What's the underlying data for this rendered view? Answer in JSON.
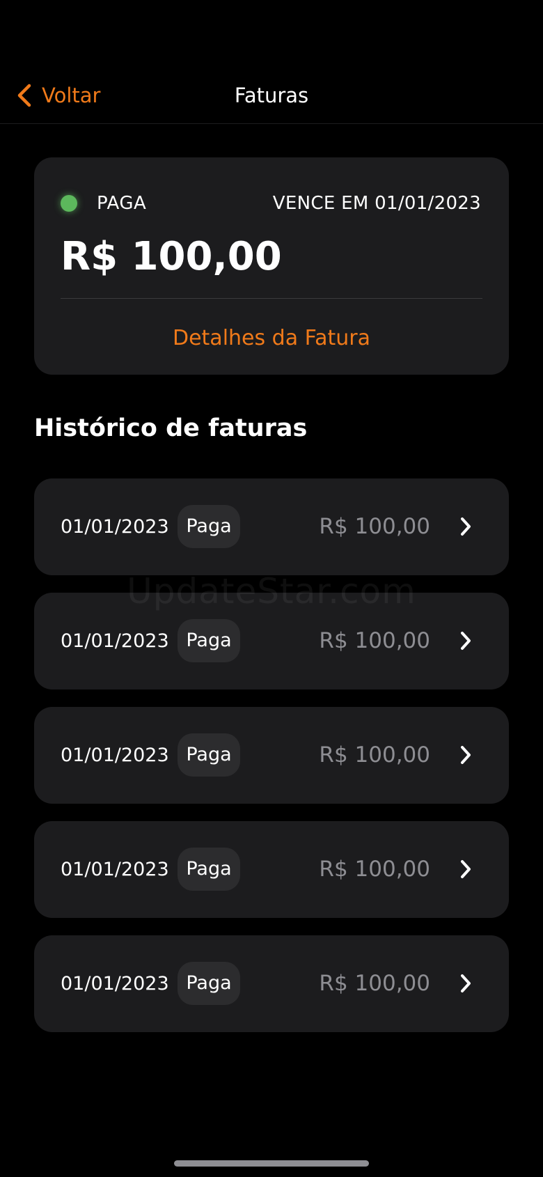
{
  "nav": {
    "back_label": "Voltar",
    "title": "Faturas"
  },
  "current_invoice": {
    "status": "PAGA",
    "status_color": "#5cb85c",
    "due": "VENCE EM 01/01/2023",
    "amount": "R$ 100,00",
    "details_link": "Detalhes da Fatura"
  },
  "history": {
    "title": "Histórico de faturas",
    "items": [
      {
        "date": "01/01/2023",
        "status": "Paga",
        "amount": "R$ 100,00"
      },
      {
        "date": "01/01/2023",
        "status": "Paga",
        "amount": "R$ 100,00"
      },
      {
        "date": "01/01/2023",
        "status": "Paga",
        "amount": "R$ 100,00"
      },
      {
        "date": "01/01/2023",
        "status": "Paga",
        "amount": "R$ 100,00"
      },
      {
        "date": "01/01/2023",
        "status": "Paga",
        "amount": "R$ 100,00"
      }
    ]
  },
  "watermark": "UpdateStar.com",
  "colors": {
    "accent": "#f07a1a",
    "background": "#000000",
    "card": "#1c1c1e"
  },
  "icons": {
    "back": "chevron-left-icon",
    "row": "chevron-right-icon"
  }
}
